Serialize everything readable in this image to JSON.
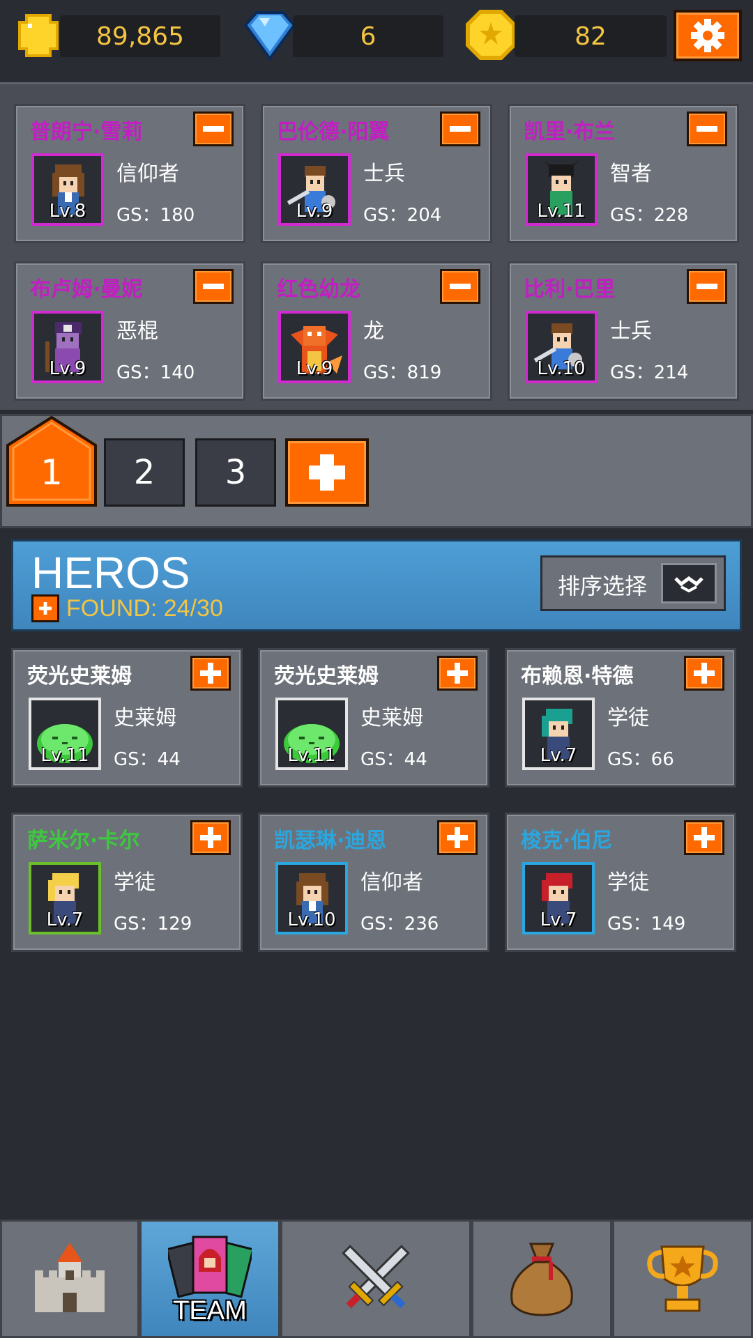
{
  "currency": {
    "gold": "89,865",
    "gems": "6",
    "medals": "82"
  },
  "team_members": [
    {
      "name": "普朗宁·雪莉",
      "class": "信仰者",
      "level": "Lv.8",
      "gs": "GS：180",
      "name_color": "#c31ec3",
      "border": "#d12ad1",
      "icon": "priestess-icon"
    },
    {
      "name": "巴伦德·阳翼",
      "class": "士兵",
      "level": "Lv.9",
      "gs": "GS：204",
      "name_color": "#c31ec3",
      "border": "#d12ad1",
      "icon": "swordsman-icon"
    },
    {
      "name": "凯里·布兰",
      "class": "智者",
      "level": "Lv.11",
      "gs": "GS：228",
      "name_color": "#c31ec3",
      "border": "#d12ad1",
      "icon": "sage-icon"
    },
    {
      "name": "布卢姆·曼妮",
      "class": "恶棍",
      "level": "Lv.9",
      "gs": "GS：140",
      "name_color": "#c31ec3",
      "border": "#d12ad1",
      "icon": "rogue-icon"
    },
    {
      "name": "红色幼龙",
      "class": "龙",
      "level": "Lv.9",
      "gs": "GS：819",
      "name_color": "#c31ec3",
      "border": "#d12ad1",
      "icon": "red-dragon-icon"
    },
    {
      "name": "比利·巴里",
      "class": "士兵",
      "level": "Lv.10",
      "gs": "GS：214",
      "name_color": "#c31ec3",
      "border": "#d12ad1",
      "icon": "swordsman-icon"
    }
  ],
  "team_tabs": [
    "1",
    "2",
    "3"
  ],
  "heros_section": {
    "title": "HEROS",
    "found": "FOUND: 24/30",
    "sort_label": "排序选择"
  },
  "heroes": [
    {
      "name": "荧光史莱姆",
      "class": "史莱姆",
      "level": "Lv.11",
      "gs": "GS：44",
      "name_color": "#ffffff",
      "border": "#e6e6e6",
      "icon": "green-slime-icon"
    },
    {
      "name": "荧光史莱姆",
      "class": "史莱姆",
      "level": "Lv.11",
      "gs": "GS：44",
      "name_color": "#ffffff",
      "border": "#e6e6e6",
      "icon": "green-slime-icon"
    },
    {
      "name": "布赖恩·特德",
      "class": "学徒",
      "level": "Lv.7",
      "gs": "GS：66",
      "name_color": "#ffffff",
      "border": "#e6e6e6",
      "icon": "apprentice-icon"
    },
    {
      "name": "萨米尔·卡尔",
      "class": "学徒",
      "level": "Lv.7",
      "gs": "GS：129",
      "name_color": "#3ec93e",
      "border": "#6bbf2a",
      "icon": "apprentice-icon"
    },
    {
      "name": "凯瑟琳·迪恩",
      "class": "信仰者",
      "level": "Lv.10",
      "gs": "GS：236",
      "name_color": "#2aa7e0",
      "border": "#2aa7e0",
      "icon": "priestess-icon"
    },
    {
      "name": "梭克·伯尼",
      "class": "学徒",
      "level": "Lv.7",
      "gs": "GS：149",
      "name_color": "#2aa7e0",
      "border": "#2aa7e0",
      "icon": "apprentice-icon"
    }
  ],
  "nav": {
    "team_label": "TEAM",
    "items": [
      "castle-icon",
      "team-cards-icon",
      "crossed-swords-icon",
      "loot-bag-icon",
      "trophy-icon"
    ]
  }
}
